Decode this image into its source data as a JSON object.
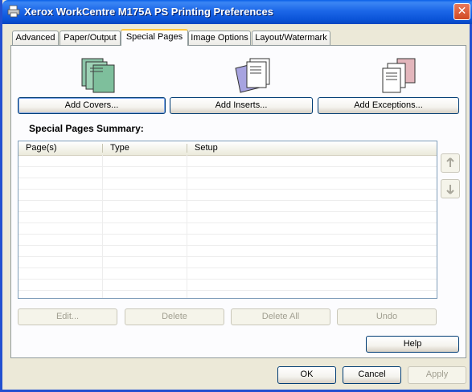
{
  "window": {
    "title": "Xerox WorkCentre M175A PS Printing Preferences",
    "close_label": "✕"
  },
  "tabs": [
    {
      "label": "Advanced"
    },
    {
      "label": "Paper/Output"
    },
    {
      "label": "Special Pages"
    },
    {
      "label": "Image Options"
    },
    {
      "label": "Layout/Watermark"
    }
  ],
  "special_pages": {
    "add_covers_label": "Add Covers...",
    "add_inserts_label": "Add Inserts...",
    "add_exceptions_label": "Add Exceptions...",
    "summary_label": "Special Pages Summary:",
    "columns": [
      "Page(s)",
      "Type",
      "Setup"
    ],
    "edit_label": "Edit...",
    "delete_label": "Delete",
    "delete_all_label": "Delete All",
    "undo_label": "Undo",
    "help_label": "Help"
  },
  "footer": {
    "ok_label": "OK",
    "cancel_label": "Cancel",
    "apply_label": "Apply"
  },
  "colors": {
    "titlebar": "#0B54D8",
    "active_tab_accent": "#FFC83C",
    "dialog_bg": "#ECE9D8"
  }
}
